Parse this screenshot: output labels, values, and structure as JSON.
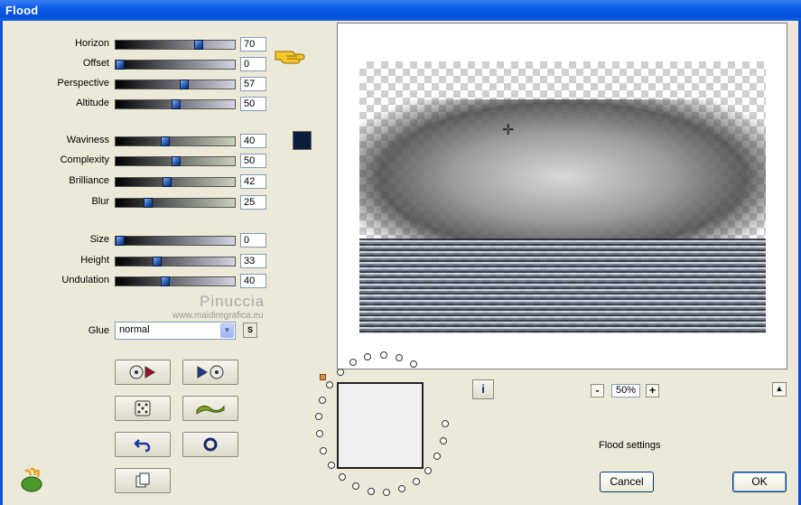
{
  "window": {
    "title": "Flood"
  },
  "sliders": {
    "horizon": {
      "label": "Horizon",
      "value": "70",
      "level": 0.7
    },
    "offset": {
      "label": "Offset",
      "value": "0",
      "level": 0.0
    },
    "perspective": {
      "label": "Perspective",
      "value": "57",
      "level": 0.57
    },
    "altitude": {
      "label": "Altitude",
      "value": "50",
      "level": 0.5
    },
    "waviness": {
      "label": "Waviness",
      "value": "40",
      "level": 0.4
    },
    "complexity": {
      "label": "Complexity",
      "value": "50",
      "level": 0.5
    },
    "brilliance": {
      "label": "Brilliance",
      "value": "42",
      "level": 0.42
    },
    "blur": {
      "label": "Blur",
      "value": "25",
      "level": 0.25
    },
    "size": {
      "label": "Size",
      "value": "0",
      "level": 0.0
    },
    "height": {
      "label": "Height",
      "value": "33",
      "level": 0.33
    },
    "undulation": {
      "label": "Undulation",
      "value": "40",
      "level": 0.4
    }
  },
  "color_swatch": "#0e1c3b",
  "watermark": {
    "name": "Pinuccia",
    "site": "www.maidiregrafica.eu"
  },
  "glue": {
    "label": "Glue",
    "value": "normal",
    "s_button": "S"
  },
  "toolbar_icons": [
    "load-preset-icon",
    "save-preset-icon",
    "random-dice-icon",
    "wave-icon",
    "undo-icon",
    "reset-icon",
    "copy-icon"
  ],
  "zoom": {
    "minus": "-",
    "value": "50%",
    "plus": "+"
  },
  "info_button": "i",
  "status": {
    "settings_label": "Flood settings"
  },
  "buttons": {
    "cancel": "Cancel",
    "ok": "OK"
  }
}
